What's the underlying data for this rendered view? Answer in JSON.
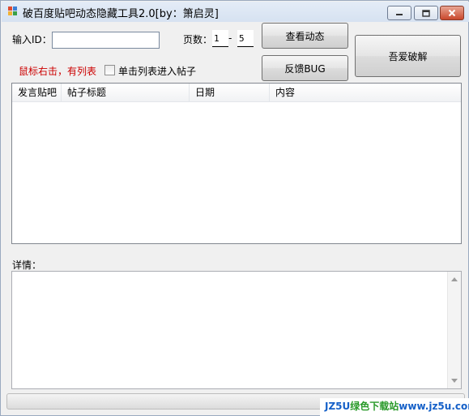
{
  "window": {
    "title": "破百度贴吧动态隐藏工具2.0[by：箫启灵]",
    "caption_buttons": [
      "minimize-icon",
      "maximize-icon",
      "close-icon"
    ]
  },
  "form": {
    "id_label": "输入ID：",
    "id_value": "",
    "pages_label": "页数：",
    "page_from": "1",
    "dash": "-",
    "page_to": "5"
  },
  "buttons": {
    "view": "查看动态",
    "feedback": "反馈BUG",
    "woai": "吾爱破解"
  },
  "hint": "鼠标右击，有列表",
  "checkbox": {
    "label": "单击列表进入帖子",
    "checked": false
  },
  "list": {
    "columns": [
      "发言贴吧",
      "帖子标题",
      "日期",
      "内容"
    ],
    "rows": []
  },
  "detail": {
    "label": "详情：",
    "value": ""
  },
  "watermark": {
    "brand": "JZ5U",
    "site_name": "绿色下载站",
    "url": "www.jz5u.com"
  },
  "colors": {
    "hint_red": "#cc0000",
    "watermark_blue": "#1560c8",
    "watermark_green": "#2a9a2a"
  }
}
